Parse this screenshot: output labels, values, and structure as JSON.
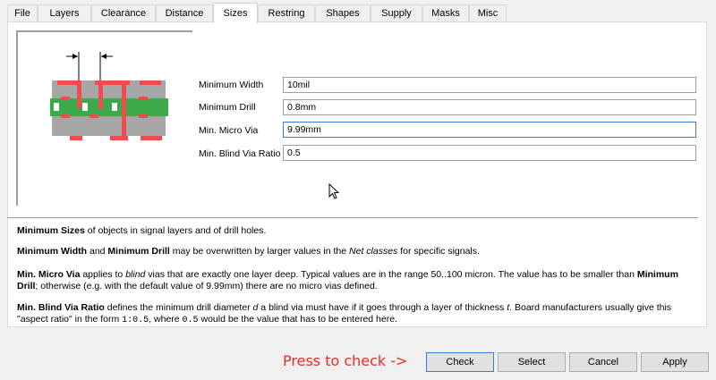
{
  "tabs": [
    "File",
    "Layers",
    "Clearance",
    "Distance",
    "Sizes",
    "Restring",
    "Shapes",
    "Supply",
    "Masks",
    "Misc"
  ],
  "active_tab": "Sizes",
  "fields": [
    {
      "label": "Minimum Width",
      "value": "10mil"
    },
    {
      "label": "Minimum Drill",
      "value": "0.8mm"
    },
    {
      "label": "Min. Micro Via",
      "value": "9.99mm"
    },
    {
      "label": "Min. Blind Via Ratio",
      "value": "0.5"
    }
  ],
  "help": {
    "p1": {
      "b1": "Minimum Sizes",
      "t1": " of objects in signal layers and of drill holes."
    },
    "p2": {
      "b1": "Minimum Width",
      "t1": " and ",
      "b2": "Minimum Drill",
      "t2": " may be overwritten by larger values in the ",
      "i1": "Net classes",
      "t3": " for specific signals."
    },
    "p3": {
      "b1": "Min. Micro Via",
      "t1": " applies to ",
      "i1": "blind",
      "t2": " vias that are exactly one layer deep. Typical values are in the range 50..100 micron. The value has to be smaller than ",
      "b2": "Minimum Drill",
      "t3": "; otherwise (e.g. with the default value of 9.99mm) there are no micro vias defined."
    },
    "p4": {
      "b1": "Min. Blind Via Ratio",
      "t1": " defines the minimum drill diameter ",
      "i1": "d",
      "t2": " a blind via must have if it goes through a layer of thickness ",
      "i2": "t",
      "t3": ". Board manufacturers usually give this \"aspect ratio\" in the form ",
      "m1": "1:0.5",
      "t4": ", where ",
      "m2": "0.5",
      "t5": " would be the value that has to be entered here."
    }
  },
  "press_text": "Press to check ->",
  "buttons": {
    "check": "Check",
    "select": "Select",
    "cancel": "Cancel",
    "apply": "Apply"
  },
  "colors": {
    "pad_red": "#ef4d4d",
    "copper_green": "#3caa4b",
    "layer_gray": "#a6a6a6",
    "press_red": "#e32d2d"
  }
}
